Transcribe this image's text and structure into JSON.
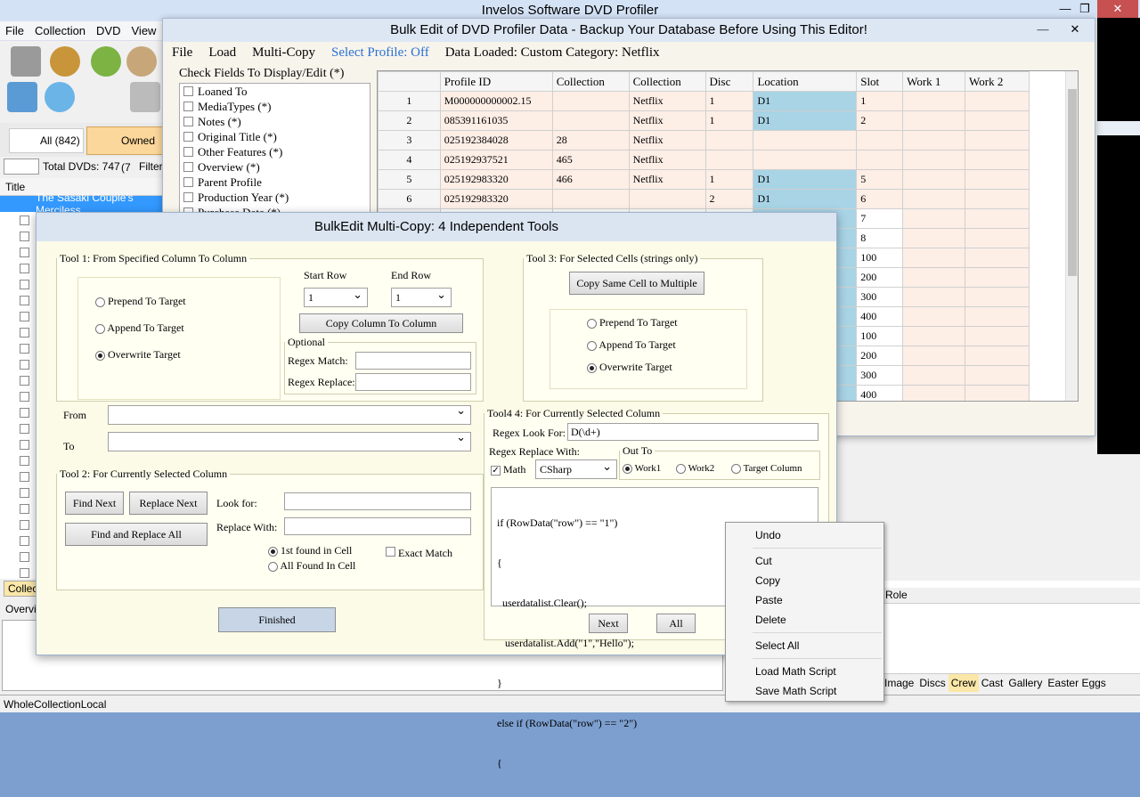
{
  "app": {
    "title": "Invelos Software DVD Profiler",
    "menu": [
      "File",
      "Collection",
      "DVD",
      "View"
    ],
    "owned_tabs": {
      "all": "All (842)",
      "owned": "Owned (7"
    },
    "total_dvds": "Total DVDs: 747",
    "filter": "Filter",
    "list_header": "Title",
    "selected_title": "The Sasaki Couple's Merciless",
    "collect_tab": "Collect",
    "overview_tab": "Overvie",
    "bottom_tabs": [
      "Image",
      "Discs",
      "Crew",
      "Cast",
      "Gallery",
      "Easter Eggs"
    ],
    "role_header": "Role",
    "status": "WholeCollectionLocal"
  },
  "bulk": {
    "title": "Bulk Edit of DVD Profiler Data - Backup Your Database Before Using This Editor!",
    "menu": {
      "file": "File",
      "load": "Load",
      "multicopy": "Multi-Copy",
      "profile": "Select Profile: Off",
      "loaded": "Data Loaded: Custom Category: Netflix"
    },
    "fields_label": "Check Fields To Display/Edit (*)",
    "fields": [
      "Loaned To",
      "MediaTypes (*)",
      "Notes (*)",
      "Original Title (*)",
      "Other Features (*)",
      "Overview (*)",
      "Parent Profile",
      "Production Year (*)",
      "Purchase Date (*)"
    ],
    "columns": [
      "Profile ID",
      "Collection",
      "Collection",
      "Disc",
      "Location",
      "Slot",
      "Work 1",
      "Work 2"
    ],
    "rows": [
      [
        "1",
        "M000000000002.15",
        "",
        "Netflix",
        "1",
        "D1",
        "1",
        "",
        ""
      ],
      [
        "2",
        "085391161035",
        "",
        "Netflix",
        "1",
        "D1",
        "2",
        "",
        ""
      ],
      [
        "3",
        "025192384028",
        "28",
        "Netflix",
        "",
        "",
        "",
        "",
        ""
      ],
      [
        "4",
        "025192937521",
        "465",
        "Netflix",
        "",
        "",
        "",
        "",
        ""
      ],
      [
        "5",
        "025192983320",
        "466",
        "Netflix",
        "1",
        "D1",
        "5",
        "",
        ""
      ],
      [
        "6",
        "025192983320",
        "",
        "",
        "2",
        "D1",
        "6",
        "",
        ""
      ],
      [
        "",
        "",
        "",
        "",
        "",
        "",
        "7",
        "",
        ""
      ],
      [
        "",
        "",
        "",
        "",
        "",
        "",
        "8",
        "",
        ""
      ],
      [
        "",
        "",
        "",
        "",
        "",
        "",
        "100",
        "",
        ""
      ],
      [
        "",
        "",
        "",
        "",
        "",
        "",
        "200",
        "",
        ""
      ],
      [
        "",
        "",
        "",
        "",
        "",
        "",
        "300",
        "",
        ""
      ],
      [
        "",
        "",
        "",
        "",
        "",
        "",
        "400",
        "",
        ""
      ],
      [
        "",
        "",
        "",
        "",
        "",
        "",
        "100",
        "",
        ""
      ],
      [
        "",
        "",
        "",
        "",
        "",
        "",
        "200",
        "",
        ""
      ],
      [
        "",
        "",
        "",
        "",
        "",
        "",
        "300",
        "",
        ""
      ],
      [
        "",
        "",
        "",
        "",
        "",
        "",
        "400",
        "",
        ""
      ]
    ]
  },
  "mc": {
    "title": "BulkEdit Multi-Copy: 4 Independent Tools",
    "tool1": {
      "legend": "Tool 1: From Specified Column To Column",
      "prepend": "Prepend To Target",
      "append": "Append To Target",
      "overwrite": "Overwrite Target",
      "start_row": "Start Row",
      "end_row": "End Row",
      "start_val": "1",
      "end_val": "1",
      "copy_btn": "Copy Column To Column",
      "optional": "Optional",
      "regex_match": "Regex Match:",
      "regex_replace": "Regex Replace:",
      "from": "From",
      "to": "To"
    },
    "tool2": {
      "legend": "Tool 2: For Currently Selected Column",
      "find_next": "Find Next",
      "replace_next": "Replace Next",
      "find_replace_all": "Find and Replace All",
      "look_for": "Look for:",
      "replace_with": "Replace With:",
      "first_found": "1st found in Cell",
      "all_found": "All Found In Cell",
      "exact": "Exact Match"
    },
    "tool3": {
      "legend": "Tool 3: For Selected Cells (strings only)",
      "copy_btn": "Copy Same Cell to Multiple",
      "prepend": "Prepend To Target",
      "append": "Append To Target",
      "overwrite": "Overwrite Target"
    },
    "tool4": {
      "legend": "Tool4 4: For Currently Selected Column",
      "regex_look": "Regex Look For:",
      "regex_val": "D(\\d+)",
      "replace_with": "Regex Replace With:",
      "math": "Math",
      "lang": "CSharp",
      "out_to": "Out To",
      "work1": "Work1",
      "work2": "Work2",
      "target": "Target Column",
      "code": [
        "if (RowData(\"row\") == \"1\")",
        "{",
        "  userdatalist.Clear();",
        "   userdatalist.Add(\"1\",\"Hello\");",
        "}",
        "else if (RowData(\"row\") == \"2\")",
        "{"
      ],
      "next": "Next",
      "all": "All"
    },
    "finished": "Finished"
  },
  "ctx": {
    "undo": "Undo",
    "cut": "Cut",
    "copy": "Copy",
    "paste": "Paste",
    "delete": "Delete",
    "select_all": "Select All",
    "load_math": "Load Math Script",
    "save_math": "Save Math Script"
  },
  "colors": {
    "netflix_row": "#fdeee6",
    "location_blue": "#a8d4e6",
    "selected_blue": "#3399ff"
  }
}
